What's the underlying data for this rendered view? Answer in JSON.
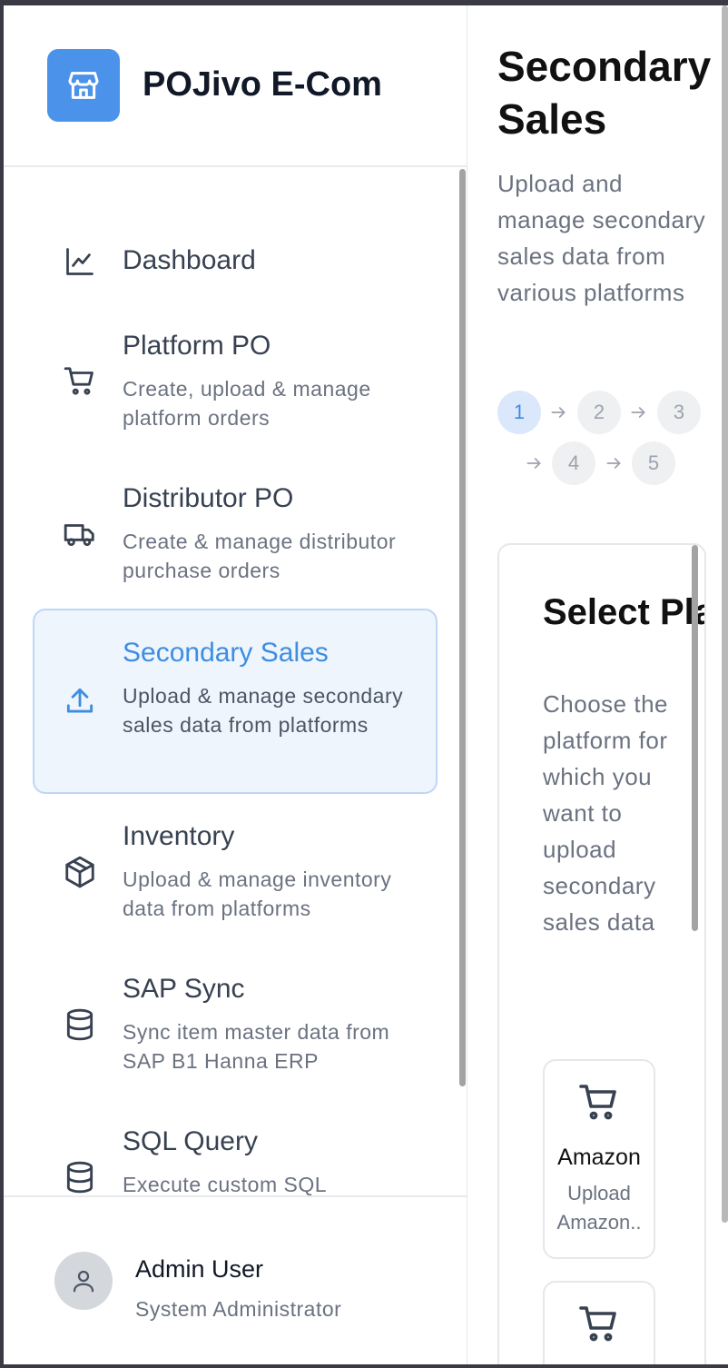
{
  "app": {
    "name": "POJivo E-Com",
    "logo_icon": "store-icon",
    "accent": "#4b93ea"
  },
  "sidebar": {
    "items": [
      {
        "title": "Dashboard",
        "desc": "",
        "icon": "line-chart-icon",
        "active": false
      },
      {
        "title": "Platform PO",
        "desc": "Create, upload & manage platform orders",
        "icon": "cart-icon",
        "active": false
      },
      {
        "title": "Distributor PO",
        "desc": "Create & manage distributor purchase orders",
        "icon": "truck-icon",
        "active": false
      },
      {
        "title": "Secondary Sales",
        "desc": "Upload & manage secondary sales data from platforms",
        "icon": "upload-icon",
        "active": true
      },
      {
        "title": "Inventory",
        "desc": "Upload & manage inventory data from platforms",
        "icon": "box-icon",
        "active": false
      },
      {
        "title": "SAP Sync",
        "desc": "Sync item master data from SAP B1 Hanna ERP",
        "icon": "database-icon",
        "active": false
      },
      {
        "title": "SQL Query",
        "desc": "Execute custom SQL",
        "icon": "database-icon",
        "active": false
      }
    ]
  },
  "user": {
    "name": "Admin User",
    "role": "System Administrator",
    "icon": "user-icon"
  },
  "main": {
    "title": "Secondary Sales",
    "subtitle": "Upload and manage secondary sales data from various platforms",
    "steps": [
      "1",
      "2",
      "3",
      "4",
      "5"
    ],
    "active_step": "1",
    "card": {
      "title": "Select Platform",
      "subtitle": "Choose the platform for which you want to upload secondary sales data",
      "platforms": [
        {
          "name": "Amazon",
          "desc": "Upload Amazon..",
          "icon": "cart-icon"
        },
        {
          "name": "",
          "desc": "",
          "icon": "cart-icon"
        }
      ]
    }
  }
}
